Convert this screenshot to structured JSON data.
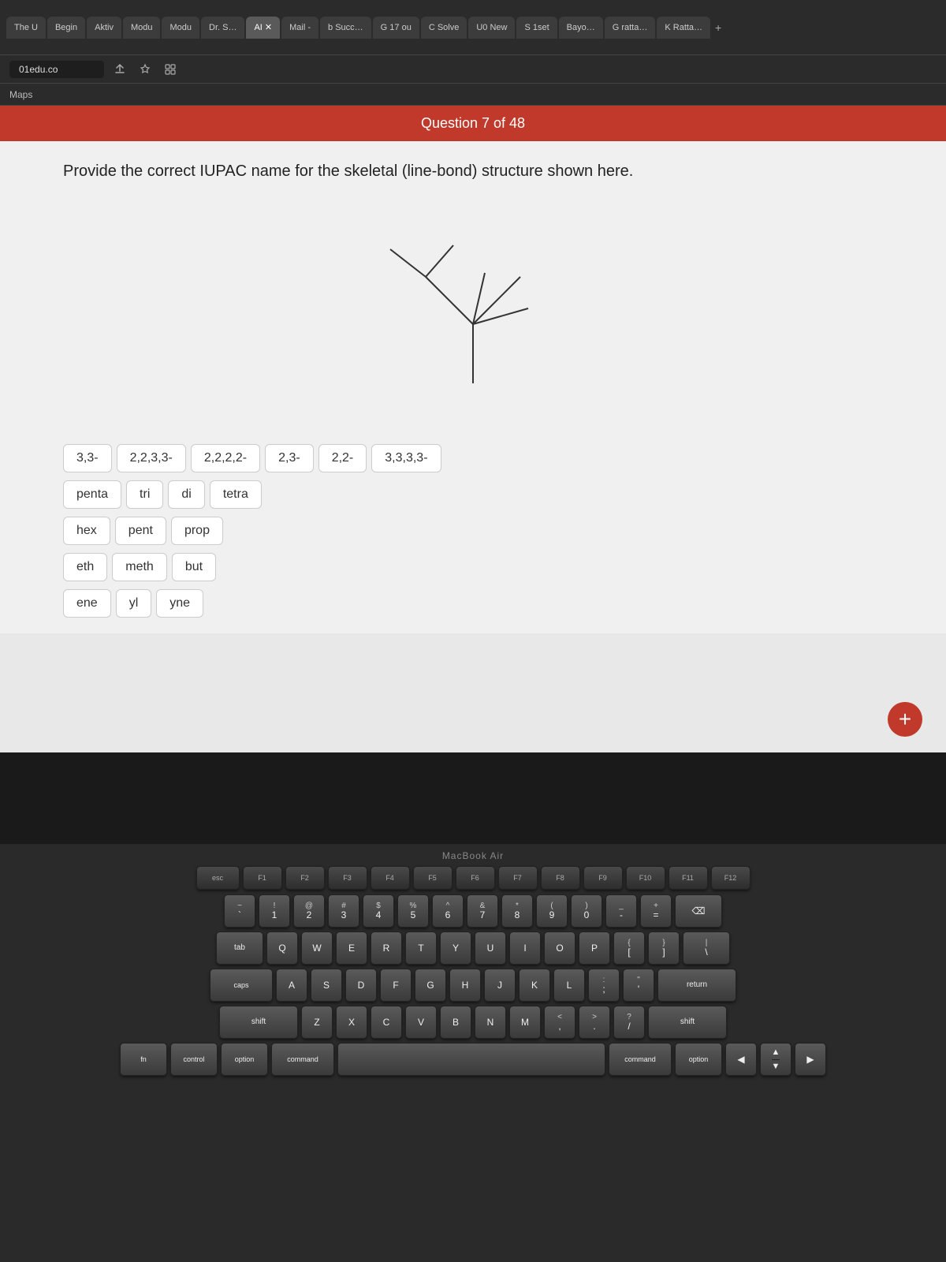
{
  "browser": {
    "tabs": [
      {
        "label": "The U",
        "active": false
      },
      {
        "label": "Begin",
        "active": false
      },
      {
        "label": "Aktiv",
        "active": false
      },
      {
        "label": "Modu",
        "active": false
      },
      {
        "label": "Modu",
        "active": false
      },
      {
        "label": "Dr. S…",
        "active": false
      },
      {
        "label": "AI",
        "active": true,
        "has_x": true
      },
      {
        "label": "Mail -",
        "active": false
      },
      {
        "label": "b Succ…",
        "active": false
      },
      {
        "label": "G 17 ou",
        "active": false
      },
      {
        "label": "C Solve",
        "active": false
      },
      {
        "label": "U0 New",
        "active": false
      },
      {
        "label": "S 1set",
        "active": false
      },
      {
        "label": "Bayo…",
        "active": false
      },
      {
        "label": "G ratta…",
        "active": false
      },
      {
        "label": "K Ratta…",
        "active": false
      }
    ],
    "url": "01edu.co",
    "bookmarks": [
      "Maps"
    ]
  },
  "question": {
    "header": "Question 7 of 48",
    "text": "Provide the correct IUPAC name for the skeletal (line-bond) structure shown here.",
    "answer_rows": [
      [
        "3,3-",
        "2,2,3,3-",
        "2,2,2,2-",
        "2,3-",
        "2,2-",
        "3,3,3,3-"
      ],
      [
        "penta",
        "tri",
        "di",
        "tetra"
      ],
      [
        "hex",
        "pent",
        "prop"
      ],
      [
        "eth",
        "meth",
        "but"
      ],
      [
        "ene",
        "yl",
        "yne"
      ]
    ]
  },
  "keyboard": {
    "macbook_label": "MacBook Air",
    "fn_row": [
      "esc",
      "F1",
      "F2",
      "F3",
      "F4",
      "F5",
      "F6",
      "F7",
      "F8",
      "F9",
      "F10",
      "F11",
      "F12"
    ],
    "row1": [
      {
        "top": "~",
        "bottom": "`"
      },
      {
        "top": "!",
        "bottom": "1"
      },
      {
        "top": "@",
        "bottom": "2"
      },
      {
        "top": "#",
        "bottom": "3"
      },
      {
        "top": "$",
        "bottom": "4"
      },
      {
        "top": "%",
        "bottom": "5"
      },
      {
        "top": "^",
        "bottom": "6"
      },
      {
        "top": "&",
        "bottom": "7"
      },
      {
        "top": "*",
        "bottom": "8"
      },
      {
        "top": "(",
        "bottom": "9"
      },
      {
        "top": ")",
        "bottom": "0"
      },
      {
        "top": "_",
        "bottom": "-"
      },
      {
        "top": "+",
        "bottom": "="
      },
      {
        "top": "",
        "bottom": "⌫",
        "wide": true
      }
    ],
    "row2_label": "tab",
    "row2": [
      "Q",
      "W",
      "E",
      "R",
      "T",
      "Y",
      "U",
      "I",
      "O",
      "P",
      "{",
      "}",
      "|"
    ],
    "row3_label": "caps",
    "row3": [
      "A",
      "S",
      "D",
      "F",
      "G",
      "H",
      "J",
      "K",
      "L",
      ";",
      "'",
      "return"
    ],
    "row4_label": "shift",
    "row4": [
      "Z",
      "X",
      "C",
      "V",
      "B",
      "N",
      "M",
      "<",
      ">",
      "?",
      "shift"
    ],
    "row5": [
      "fn",
      "control",
      "option",
      "command",
      "",
      "command",
      "option",
      "<",
      ">",
      "↑",
      "↓"
    ]
  },
  "plus_button_label": "+"
}
